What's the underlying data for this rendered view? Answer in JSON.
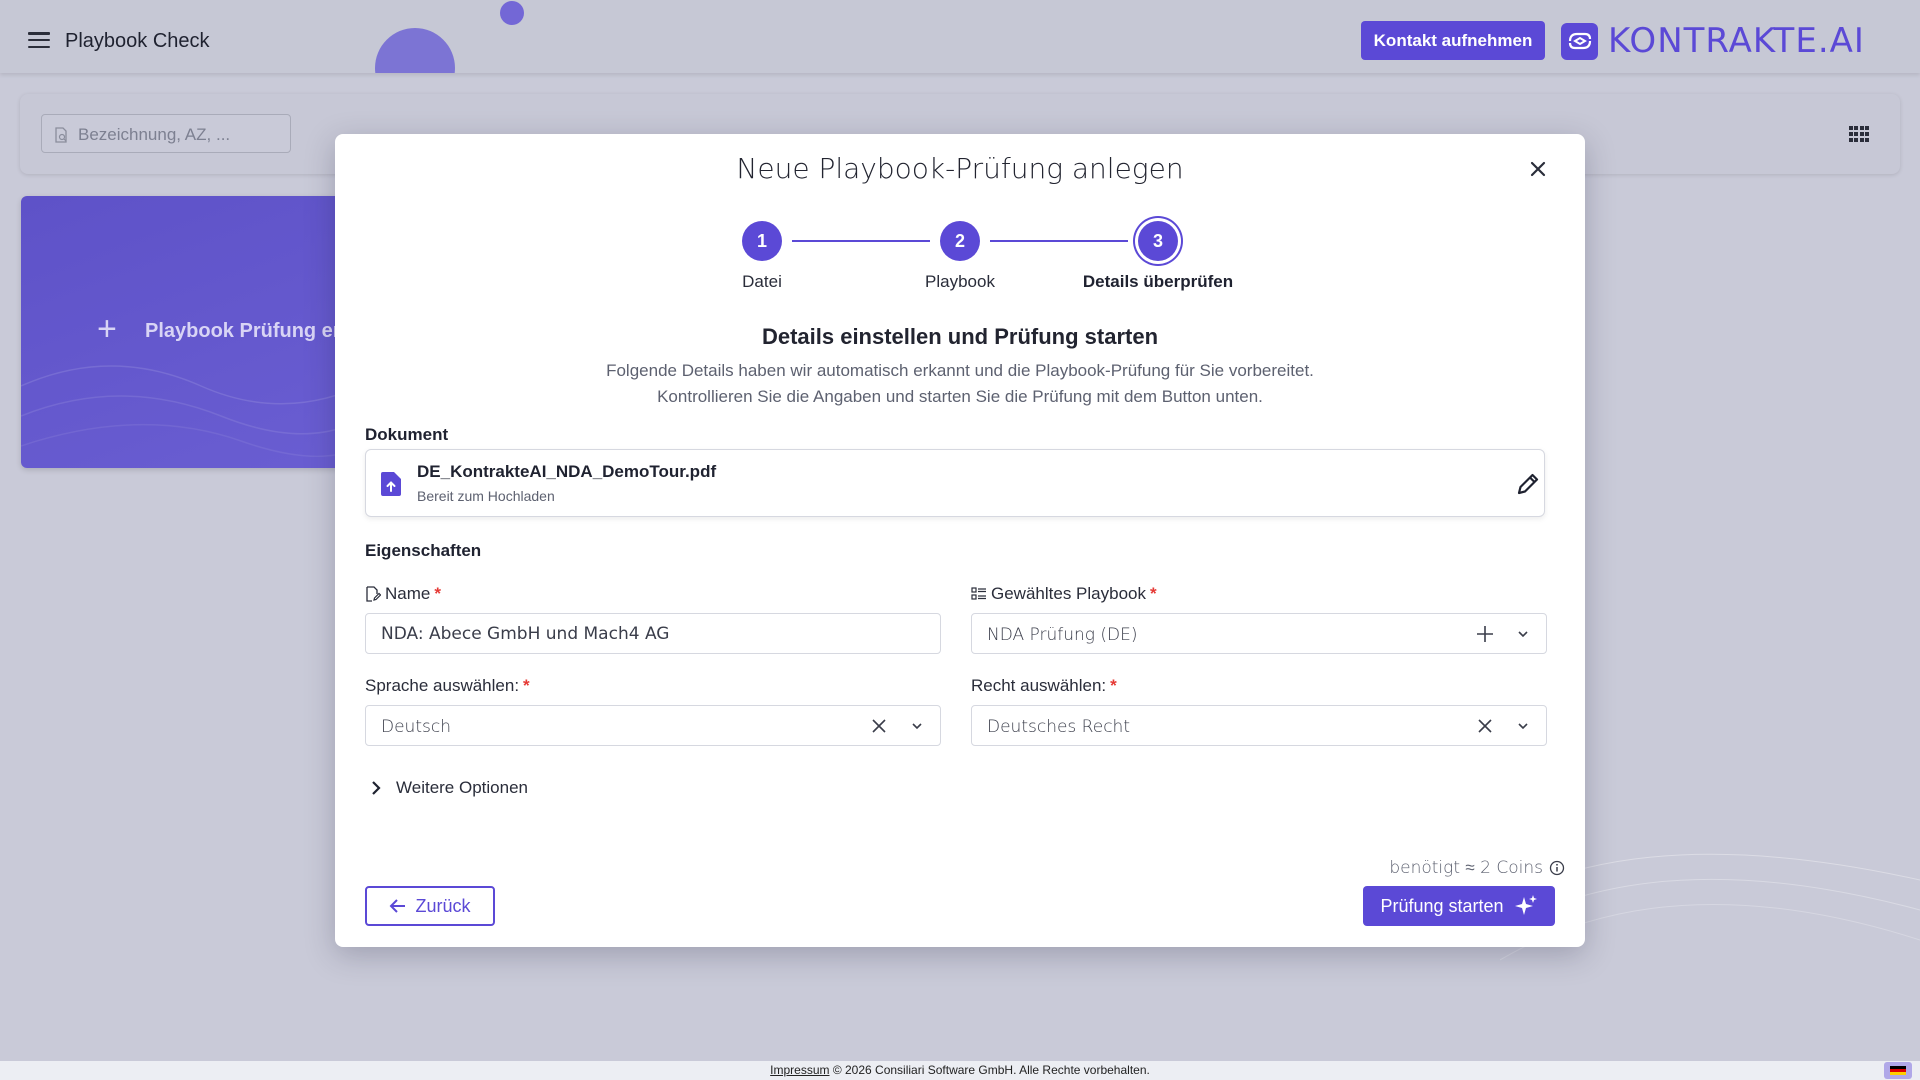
{
  "header": {
    "app_title": "Playbook Check",
    "contact_button": "Kontakt aufnehmen",
    "logo_text": "KONTRAKTE.AI"
  },
  "search": {
    "placeholder": "Bezeichnung, AZ, ..."
  },
  "create_card": {
    "label": "Playbook Prüfung erstellen"
  },
  "modal": {
    "title": "Neue Playbook-Prüfung anlegen",
    "steps": [
      {
        "number": "1",
        "label": "Datei"
      },
      {
        "number": "2",
        "label": "Playbook"
      },
      {
        "number": "3",
        "label": "Details überprüfen"
      }
    ],
    "active_step": 3,
    "heading": "Details einstellen und Prüfung starten",
    "description_line1": "Folgende Details haben wir automatisch erkannt und die Playbook-Prüfung für Sie vorbereitet.",
    "description_line2": "Kontrollieren Sie die Angaben und starten Sie die Prüfung mit dem Button unten.",
    "document_label": "Dokument",
    "document": {
      "filename": "DE_KontrakteAI_NDA_DemoTour.pdf",
      "status": "Bereit zum Hochladen"
    },
    "properties_label": "Eigenschaften",
    "fields": {
      "name": {
        "label": "Name",
        "value": "NDA: Abece GmbH und Mach4 AG"
      },
      "playbook": {
        "label": "Gewähltes Playbook",
        "value": "NDA Prüfung (DE)"
      },
      "language": {
        "label": "Sprache auswählen:",
        "value": "Deutsch"
      },
      "law": {
        "label": "Recht auswählen:",
        "value": "Deutsches Recht"
      }
    },
    "required_marker": "*",
    "more_options": "Weitere Optionen",
    "coins_note": "benötigt ≈ 2 Coins",
    "back_button": "Zurück",
    "start_button": "Prüfung starten"
  },
  "footer": {
    "impressum": "Impressum",
    "copyright": " © 2026 Consiliari Software GmbH. Alle Rechte vorbehalten."
  },
  "colors": {
    "accent": "#5b49d6",
    "required": "#e53935"
  }
}
